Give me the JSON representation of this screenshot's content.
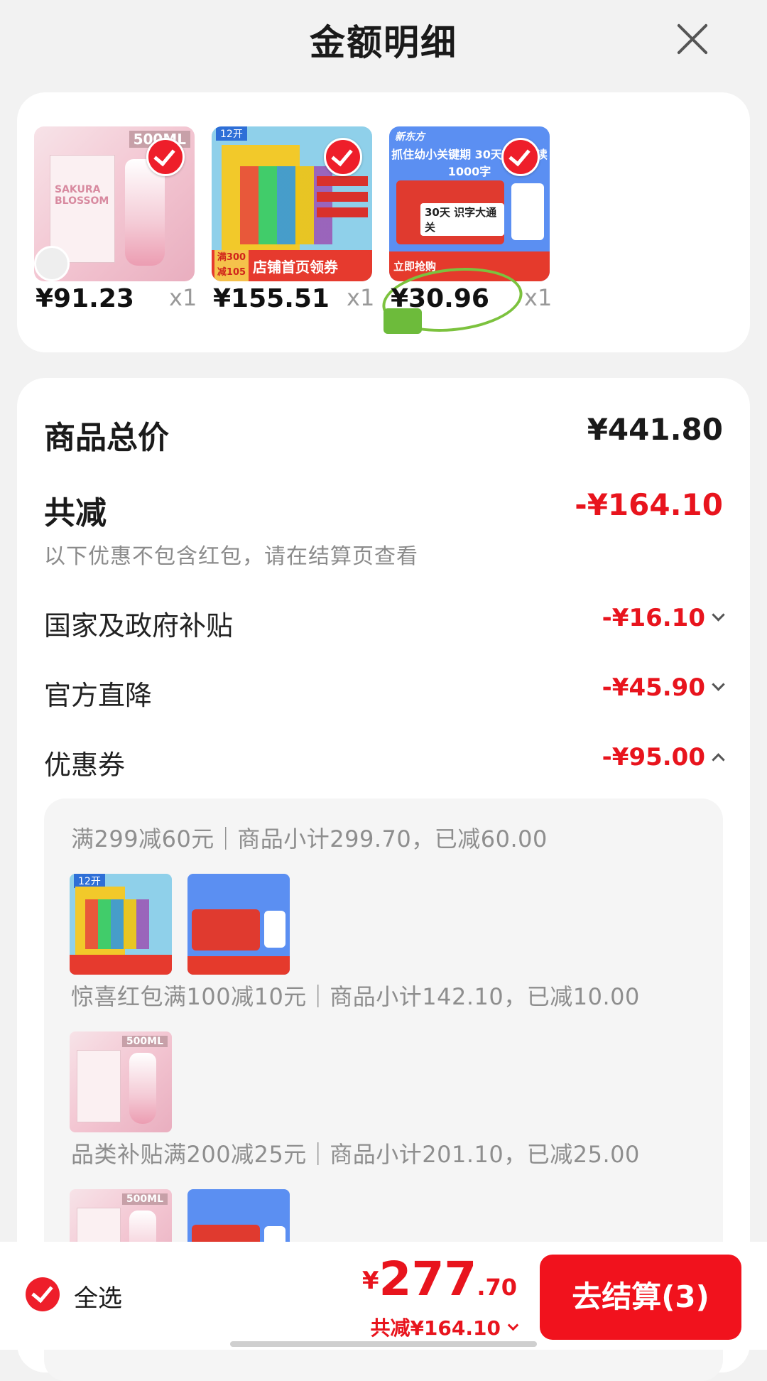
{
  "header": {
    "title": "金额明细"
  },
  "products": [
    {
      "price": "¥91.23",
      "qty": "x1",
      "image": {
        "capacity": "500ML",
        "brand": "SAKURA BLOSSOM"
      }
    },
    {
      "price": "¥155.51",
      "qty": "x1",
      "image": {
        "tag": "12开",
        "promo_badge": "满300 减105",
        "promo_text": "店铺首页领券"
      }
    },
    {
      "price": "¥30.96",
      "qty": "x1",
      "image": {
        "logo": "新东方",
        "headline": "抓住幼小关键期 30天轻松认读1000字",
        "kit_title": "30天 识字大通关",
        "bar_text": "立即抢购"
      }
    }
  ],
  "summary": {
    "total_label": "商品总价",
    "total_value": "¥441.80",
    "discount_label": "共减",
    "discount_value": "-¥164.10",
    "note": "以下优惠不包含红包，请在结算页查看",
    "items": [
      {
        "label": "国家及政府补贴",
        "value": "-¥16.10",
        "expanded": false
      },
      {
        "label": "官方直降",
        "value": "-¥45.90",
        "expanded": false
      },
      {
        "label": "优惠券",
        "value": "-¥95.00",
        "expanded": true
      }
    ]
  },
  "coupons": [
    {
      "text": "满299减60元｜商品小计299.70，已减60.00"
    },
    {
      "text": "惊喜红包满100减10元｜商品小计142.10，已减10.00"
    },
    {
      "text": "品类补贴满200减25元｜商品小计201.10，已减25.00"
    }
  ],
  "footer": {
    "select_all": "全选",
    "currency": "¥",
    "pay_int": "277",
    "pay_dec": ".70",
    "saving": "共减¥164.10",
    "checkout": "去结算(3)"
  },
  "colors": {
    "accent": "#f1121d",
    "price_red": "#e8141d",
    "muted": "#8e8e8e"
  }
}
